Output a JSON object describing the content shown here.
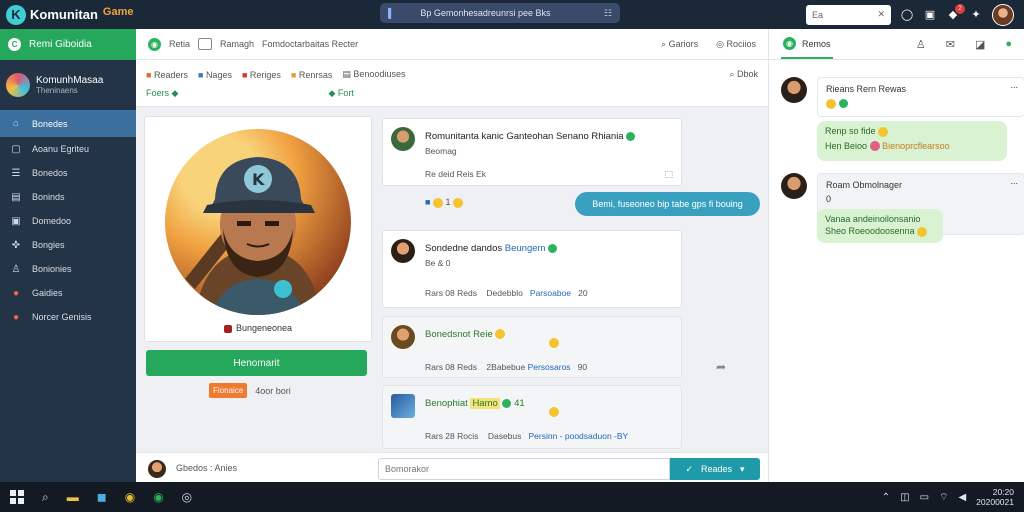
{
  "app": {
    "logo_letter": "K",
    "title": "Komunitan",
    "title_accent": "Game",
    "title_sub": ""
  },
  "topbar": {
    "search_text": "Bp Gemonhesadreunrsi pee Bks",
    "search_right": "☷",
    "input_value": "Ea",
    "input_icon": "✕",
    "notif_count": "2"
  },
  "sidebar": {
    "top_label": "Remi Giboidia",
    "user_name": "KomunhMasaa",
    "user_sub": "Theninaens",
    "items": [
      {
        "label": "Bonedes",
        "icon": "home-icon",
        "glyph": "⌂",
        "active": true
      },
      {
        "label": "Aoanu Egriteu",
        "icon": "square-icon",
        "glyph": "▢"
      },
      {
        "label": "Bonedos",
        "icon": "list-icon",
        "glyph": "☰"
      },
      {
        "label": "Boninds",
        "icon": "grid-icon",
        "glyph": "▤"
      },
      {
        "label": "Domedoo",
        "icon": "box-icon",
        "glyph": "▣"
      },
      {
        "label": "Bongies",
        "icon": "puzzle-icon",
        "glyph": "✜"
      },
      {
        "label": "Bonionies",
        "icon": "user-icon",
        "glyph": "♙"
      },
      {
        "label": "Gaidies",
        "icon": "flame-icon",
        "glyph": "●",
        "orange": true
      },
      {
        "label": "Norcer Genisis",
        "icon": "flame-icon",
        "glyph": "●",
        "orange": true
      }
    ]
  },
  "center_head": {
    "a": "Retia",
    "b": "Ramagh",
    "c": "Fomdoctarbaitas Recter"
  },
  "header_actions": [
    {
      "label": "Gariors",
      "glyph": "⌕"
    },
    {
      "label": "Rociios",
      "glyph": "◎"
    }
  ],
  "filters": {
    "items": [
      "Readers",
      "Nages",
      "Reriges",
      "Renrsas",
      "Benoodiuses"
    ],
    "right": "Dbok",
    "tag1": "Foers",
    "tag2": "Fort"
  },
  "profile": {
    "name": "Bungeneonea",
    "follow_label": "Henomarit",
    "tag": "Fionaice",
    "tag_note": "4oor bori"
  },
  "posts": [
    {
      "title": "Romunitanta kanic Ganteohan Senano Rhiania",
      "sub": "Beomag",
      "meta": "Re deid Reis Ek",
      "meta2": "1"
    },
    {
      "title": "Sondedne dandos",
      "title_link": "Beungem",
      "meta": "Be & 0",
      "meta3": "Rars 08 Reds",
      "meta3b": "Dedebblo",
      "link": "Parsoaboe",
      "num": "20"
    },
    {
      "title": "Bonedsnot Reie",
      "meta": "Rars 08 Reds",
      "meta_b": "2Babebue",
      "link": "Persosaros",
      "num": "90"
    },
    {
      "title": "Benophiat",
      "title_link": "Hamo",
      "title_num": "41",
      "meta": "Rars 28 Rocis",
      "meta_b": "Dasebus",
      "link": "Persinn - poodsaduon",
      "num": "-BY"
    }
  ],
  "blue_bubble": "Bemi, fuseoneo bip tabe gps fi bouing",
  "compose": {
    "label": "Gbedos : Anies",
    "placeholder": "Bomorakor",
    "send_label": "Reades"
  },
  "right": {
    "tab_label": "Remos",
    "chats": [
      {
        "name": "Rieans Rern Rewas",
        "more": "...",
        "msg1": "Renp so fide",
        "msg2a": "Hen Beioo",
        "msg2b": "Bienoprcflearsoo"
      },
      {
        "name": "Roam Obmolnager",
        "more": "...",
        "sub": "0",
        "msg1": "Vanaa andeinoilonsanio",
        "msg2": "Sheo Roeoodoosenna"
      }
    ]
  },
  "taskbar": {
    "time": "20:20",
    "date": "20200021"
  },
  "colors": {
    "accent_green": "#25a85b",
    "sidebar": "#243447",
    "topbar": "#1b2838",
    "link": "#2468b8"
  }
}
